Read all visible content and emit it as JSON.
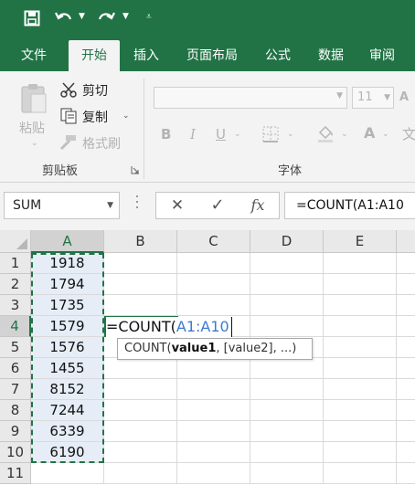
{
  "qat": {
    "save_icon": "save-icon",
    "undo_icon": "undo-icon",
    "redo_icon": "redo-icon",
    "customize_icon": "customize-qat-icon"
  },
  "tabs": [
    "文件",
    "开始",
    "插入",
    "页面布局",
    "公式",
    "数据",
    "审阅"
  ],
  "active_tab": "开始",
  "ribbon": {
    "clipboard": {
      "paste": "粘贴",
      "cut": "剪切",
      "copy": "复制",
      "format_painter": "格式刷",
      "group_label": "剪贴板"
    },
    "font": {
      "font_name": "",
      "font_size": "11",
      "group_label": "字体"
    }
  },
  "formula_bar": {
    "name_box": "SUM",
    "cancel_icon": "✕",
    "enter_icon": "✓",
    "fx": "fx",
    "formula": "=COUNT(A1:A10"
  },
  "grid": {
    "columns": [
      "A",
      "B",
      "C",
      "D",
      "E"
    ],
    "rows": [
      "1",
      "2",
      "3",
      "4",
      "5",
      "6",
      "7",
      "8",
      "9",
      "10",
      "11"
    ],
    "column_a": [
      "1918",
      "1794",
      "1735",
      "1579",
      "1576",
      "1455",
      "8152",
      "7244",
      "6339",
      "6190",
      ""
    ],
    "active_cell": {
      "ref": "B4",
      "prefix": "=COUNT(",
      "range": "A1:A10"
    },
    "tooltip": {
      "func": "COUNT(",
      "arg1": "value1",
      "rest": ", [value2], ...)"
    }
  },
  "colors": {
    "excel_green": "#217346",
    "selection_fill": "#e6edf6",
    "range_ref_blue": "#3a7bd5"
  }
}
